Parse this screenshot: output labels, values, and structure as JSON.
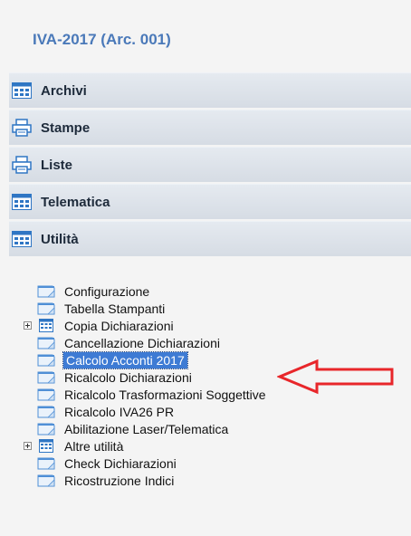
{
  "header": {
    "title": "IVA-2017  (Arc. 001)"
  },
  "menu": [
    {
      "label": "Archivi",
      "icon": "calculator-icon"
    },
    {
      "label": "Stampe",
      "icon": "printer-icon"
    },
    {
      "label": "Liste",
      "icon": "printer-icon"
    },
    {
      "label": "Telematica",
      "icon": "calculator-icon"
    },
    {
      "label": "Utilità",
      "icon": "calculator-icon"
    }
  ],
  "tree": [
    {
      "label": "Configurazione",
      "icon": "window-icon",
      "expandable": false,
      "selected": false
    },
    {
      "label": "Tabella Stampanti",
      "icon": "window-icon",
      "expandable": false,
      "selected": false
    },
    {
      "label": "Copia Dichiarazioni",
      "icon": "calculator-icon",
      "expandable": true,
      "selected": false
    },
    {
      "label": "Cancellazione Dichiarazioni",
      "icon": "window-icon",
      "expandable": false,
      "selected": false
    },
    {
      "label": "Calcolo Acconti 2017",
      "icon": "window-icon",
      "expandable": false,
      "selected": true
    },
    {
      "label": "Ricalcolo Dichiarazioni",
      "icon": "window-icon",
      "expandable": false,
      "selected": false
    },
    {
      "label": "Ricalcolo Trasformazioni Soggettive",
      "icon": "window-icon",
      "expandable": false,
      "selected": false
    },
    {
      "label": "Ricalcolo IVA26 PR",
      "icon": "window-icon",
      "expandable": false,
      "selected": false
    },
    {
      "label": "Abilitazione Laser/Telematica",
      "icon": "window-icon",
      "expandable": false,
      "selected": false
    },
    {
      "label": "Altre utilità",
      "icon": "calculator-icon",
      "expandable": true,
      "selected": false
    },
    {
      "label": "Check Dichiarazioni",
      "icon": "window-icon",
      "expandable": false,
      "selected": false
    },
    {
      "label": "Ricostruzione Indici",
      "icon": "window-icon",
      "expandable": false,
      "selected": false
    }
  ],
  "colors": {
    "title": "#4a79b9",
    "selection": "#3e7bd4",
    "arrow": "#e8262a"
  },
  "annotation": {
    "icon": "red-arrow-icon",
    "points_to": "Calcolo Acconti 2017"
  }
}
